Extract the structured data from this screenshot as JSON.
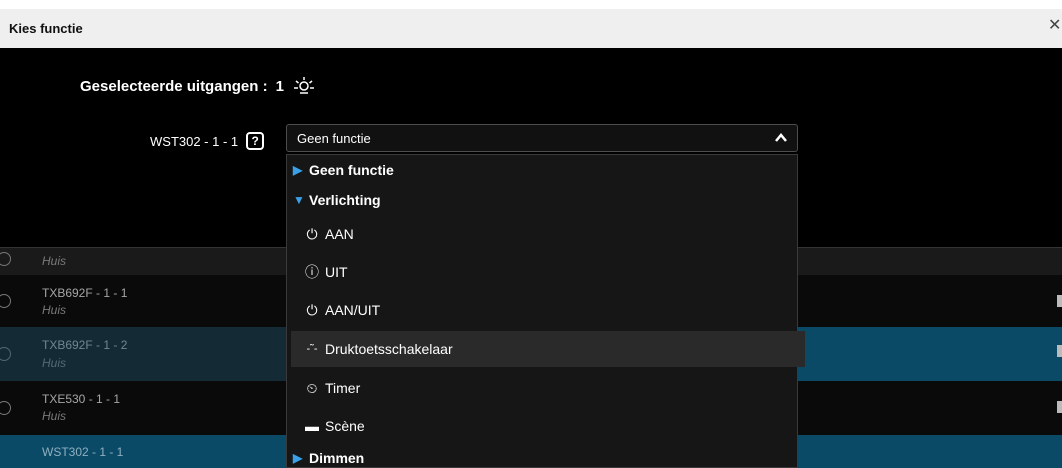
{
  "dialog": {
    "title": "Kies functie",
    "close_glyph": "✕"
  },
  "selected": {
    "label": "Geselecteerde uitgangen :",
    "count": "1",
    "icon": "light-bulb-icon"
  },
  "field": {
    "label": "WST302 - 1 - 1",
    "help_glyph": "?",
    "select_value": "Geen functie",
    "caret": "⌃"
  },
  "dropdown": {
    "items": [
      {
        "kind": "group",
        "label": "Geen functie",
        "expanded": false
      },
      {
        "kind": "group",
        "label": "Verlichting",
        "expanded": true
      },
      {
        "kind": "option",
        "label": "AAN",
        "icon": "switch-on-icon",
        "glyph": "⏻"
      },
      {
        "kind": "option",
        "label": "UIT",
        "icon": "switch-off-icon",
        "glyph": "ⓘ"
      },
      {
        "kind": "option",
        "label": "AAN/UIT",
        "icon": "power-icon",
        "glyph": "⏻"
      },
      {
        "kind": "option",
        "label": "Druktoetsschakelaar",
        "icon": "pushbutton-icon",
        "glyph": "-˜-",
        "highlighted": true
      },
      {
        "kind": "option",
        "label": "Timer",
        "icon": "timer-icon",
        "glyph": "⏲"
      },
      {
        "kind": "option",
        "label": "Scène",
        "icon": "scene-icon",
        "glyph": "▬"
      },
      {
        "kind": "group",
        "label": "Dimmen",
        "expanded": false
      }
    ]
  },
  "list": {
    "rows": [
      {
        "name": "",
        "sub": "Huis",
        "selected": false
      },
      {
        "name": "TXB692F - 1 - 1",
        "sub": "Huis",
        "selected": false
      },
      {
        "name": "TXB692F - 1 - 2",
        "sub": "Huis",
        "selected": true
      },
      {
        "name": "TXE530 - 1 - 1",
        "sub": "Huis",
        "selected": false
      },
      {
        "name": "WST302 - 1 - 1",
        "sub": "",
        "selected": true
      }
    ]
  },
  "colors": {
    "selected_row": "#0b4a66",
    "row_dark": "#1a1a1a",
    "row_black": "#0a0a0a",
    "accent": "#3aa0e8"
  }
}
